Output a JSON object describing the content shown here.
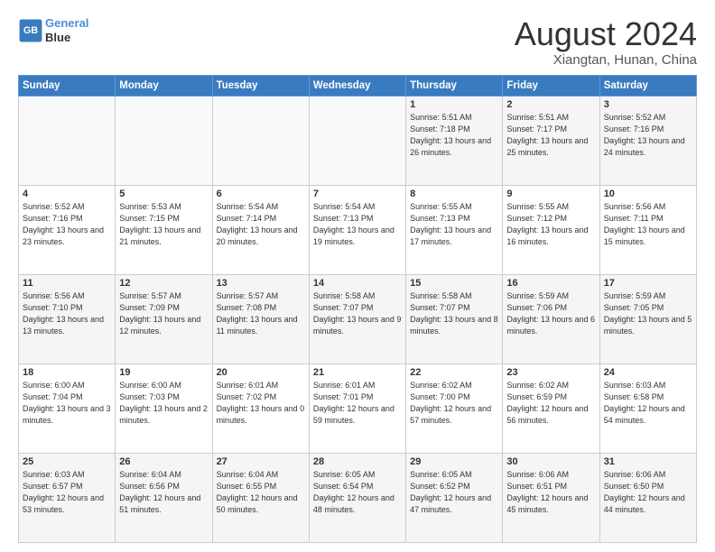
{
  "header": {
    "logo_line1": "General",
    "logo_line2": "Blue",
    "title": "August 2024",
    "subtitle": "Xiangtan, Hunan, China"
  },
  "weekdays": [
    "Sunday",
    "Monday",
    "Tuesday",
    "Wednesday",
    "Thursday",
    "Friday",
    "Saturday"
  ],
  "weeks": [
    [
      {
        "day": "",
        "info": ""
      },
      {
        "day": "",
        "info": ""
      },
      {
        "day": "",
        "info": ""
      },
      {
        "day": "",
        "info": ""
      },
      {
        "day": "1",
        "info": "Sunrise: 5:51 AM\nSunset: 7:18 PM\nDaylight: 13 hours\nand 26 minutes."
      },
      {
        "day": "2",
        "info": "Sunrise: 5:51 AM\nSunset: 7:17 PM\nDaylight: 13 hours\nand 25 minutes."
      },
      {
        "day": "3",
        "info": "Sunrise: 5:52 AM\nSunset: 7:16 PM\nDaylight: 13 hours\nand 24 minutes."
      }
    ],
    [
      {
        "day": "4",
        "info": "Sunrise: 5:52 AM\nSunset: 7:16 PM\nDaylight: 13 hours\nand 23 minutes."
      },
      {
        "day": "5",
        "info": "Sunrise: 5:53 AM\nSunset: 7:15 PM\nDaylight: 13 hours\nand 21 minutes."
      },
      {
        "day": "6",
        "info": "Sunrise: 5:54 AM\nSunset: 7:14 PM\nDaylight: 13 hours\nand 20 minutes."
      },
      {
        "day": "7",
        "info": "Sunrise: 5:54 AM\nSunset: 7:13 PM\nDaylight: 13 hours\nand 19 minutes."
      },
      {
        "day": "8",
        "info": "Sunrise: 5:55 AM\nSunset: 7:13 PM\nDaylight: 13 hours\nand 17 minutes."
      },
      {
        "day": "9",
        "info": "Sunrise: 5:55 AM\nSunset: 7:12 PM\nDaylight: 13 hours\nand 16 minutes."
      },
      {
        "day": "10",
        "info": "Sunrise: 5:56 AM\nSunset: 7:11 PM\nDaylight: 13 hours\nand 15 minutes."
      }
    ],
    [
      {
        "day": "11",
        "info": "Sunrise: 5:56 AM\nSunset: 7:10 PM\nDaylight: 13 hours\nand 13 minutes."
      },
      {
        "day": "12",
        "info": "Sunrise: 5:57 AM\nSunset: 7:09 PM\nDaylight: 13 hours\nand 12 minutes."
      },
      {
        "day": "13",
        "info": "Sunrise: 5:57 AM\nSunset: 7:08 PM\nDaylight: 13 hours\nand 11 minutes."
      },
      {
        "day": "14",
        "info": "Sunrise: 5:58 AM\nSunset: 7:07 PM\nDaylight: 13 hours\nand 9 minutes."
      },
      {
        "day": "15",
        "info": "Sunrise: 5:58 AM\nSunset: 7:07 PM\nDaylight: 13 hours\nand 8 minutes."
      },
      {
        "day": "16",
        "info": "Sunrise: 5:59 AM\nSunset: 7:06 PM\nDaylight: 13 hours\nand 6 minutes."
      },
      {
        "day": "17",
        "info": "Sunrise: 5:59 AM\nSunset: 7:05 PM\nDaylight: 13 hours\nand 5 minutes."
      }
    ],
    [
      {
        "day": "18",
        "info": "Sunrise: 6:00 AM\nSunset: 7:04 PM\nDaylight: 13 hours\nand 3 minutes."
      },
      {
        "day": "19",
        "info": "Sunrise: 6:00 AM\nSunset: 7:03 PM\nDaylight: 13 hours\nand 2 minutes."
      },
      {
        "day": "20",
        "info": "Sunrise: 6:01 AM\nSunset: 7:02 PM\nDaylight: 13 hours\nand 0 minutes."
      },
      {
        "day": "21",
        "info": "Sunrise: 6:01 AM\nSunset: 7:01 PM\nDaylight: 12 hours\nand 59 minutes."
      },
      {
        "day": "22",
        "info": "Sunrise: 6:02 AM\nSunset: 7:00 PM\nDaylight: 12 hours\nand 57 minutes."
      },
      {
        "day": "23",
        "info": "Sunrise: 6:02 AM\nSunset: 6:59 PM\nDaylight: 12 hours\nand 56 minutes."
      },
      {
        "day": "24",
        "info": "Sunrise: 6:03 AM\nSunset: 6:58 PM\nDaylight: 12 hours\nand 54 minutes."
      }
    ],
    [
      {
        "day": "25",
        "info": "Sunrise: 6:03 AM\nSunset: 6:57 PM\nDaylight: 12 hours\nand 53 minutes."
      },
      {
        "day": "26",
        "info": "Sunrise: 6:04 AM\nSunset: 6:56 PM\nDaylight: 12 hours\nand 51 minutes."
      },
      {
        "day": "27",
        "info": "Sunrise: 6:04 AM\nSunset: 6:55 PM\nDaylight: 12 hours\nand 50 minutes."
      },
      {
        "day": "28",
        "info": "Sunrise: 6:05 AM\nSunset: 6:54 PM\nDaylight: 12 hours\nand 48 minutes."
      },
      {
        "day": "29",
        "info": "Sunrise: 6:05 AM\nSunset: 6:52 PM\nDaylight: 12 hours\nand 47 minutes."
      },
      {
        "day": "30",
        "info": "Sunrise: 6:06 AM\nSunset: 6:51 PM\nDaylight: 12 hours\nand 45 minutes."
      },
      {
        "day": "31",
        "info": "Sunrise: 6:06 AM\nSunset: 6:50 PM\nDaylight: 12 hours\nand 44 minutes."
      }
    ]
  ]
}
